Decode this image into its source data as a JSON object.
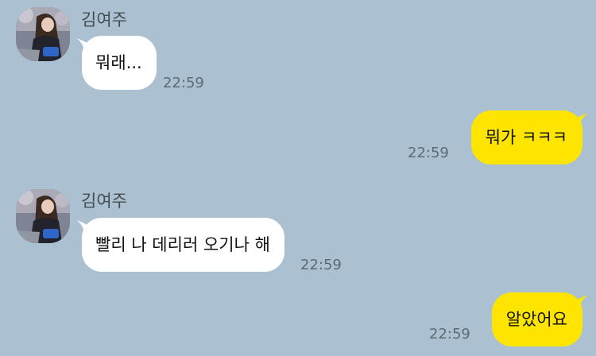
{
  "messages": [
    {
      "direction": "incoming",
      "sender": "김여주",
      "text": "뭐래...",
      "time": "22:59"
    },
    {
      "direction": "outgoing",
      "text": "뭐가 ㅋㅋㅋ",
      "time": "22:59"
    },
    {
      "direction": "incoming",
      "sender": "김여주",
      "text": "빨리 나 데리러 오기나 해",
      "time": "22:59"
    },
    {
      "direction": "outgoing",
      "text": "알았어요",
      "time": "22:59"
    }
  ],
  "colors": {
    "background": "#ABC1D1",
    "incoming_bubble": "#FFFFFF",
    "outgoing_bubble": "#FEE500",
    "timestamp": "#5b6a76",
    "sender_name": "#444a50"
  },
  "icons": {
    "avatar": "profile-photo"
  }
}
